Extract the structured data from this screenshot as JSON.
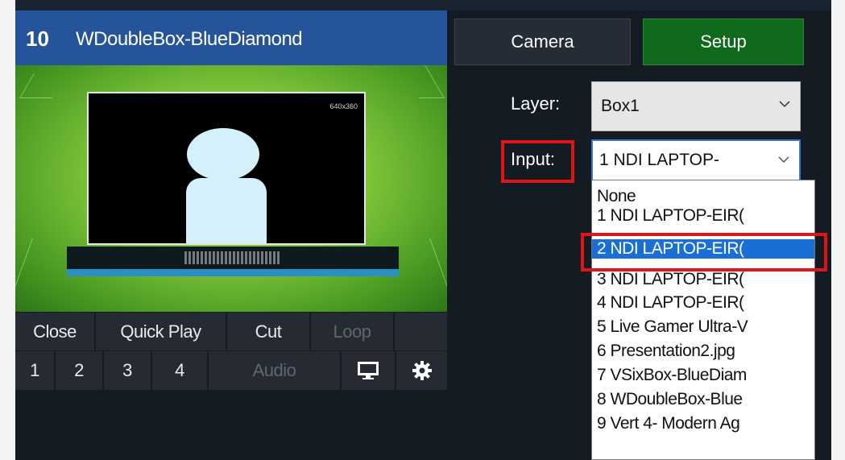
{
  "input_panel": {
    "number": "10",
    "title": "WDoubleBox-BlueDiamond",
    "resolution": "640x360",
    "controls_row1": [
      {
        "label": "Close",
        "enabled": true
      },
      {
        "label": "Quick Play",
        "enabled": true
      },
      {
        "label": "Cut",
        "enabled": true
      },
      {
        "label": "Loop",
        "enabled": false
      }
    ],
    "controls_row2": [
      {
        "label": "1"
      },
      {
        "label": "2"
      },
      {
        "label": "3"
      },
      {
        "label": "4"
      },
      {
        "label": "Audio",
        "enabled": false
      }
    ],
    "icons": [
      "monitor-icon",
      "gear-icon"
    ]
  },
  "tabs": {
    "camera": "Camera",
    "setup": "Setup",
    "setup_color": "#0f6b1b"
  },
  "layer": {
    "label": "Layer:",
    "value": "Box1"
  },
  "input": {
    "label": "Input:",
    "value": "1 NDI LAPTOP-"
  },
  "dropdown": {
    "selected_index": 2,
    "options": [
      "None",
      "1 NDI LAPTOP-EIR(",
      "2 NDI LAPTOP-EIR(",
      "3 NDI LAPTOP-EIR(",
      "4 NDI LAPTOP-EIR(",
      "5 Live Gamer Ultra-V",
      "6 Presentation2.jpg",
      "7 VSixBox-BlueDiam",
      "8 WDoubleBox-Blue",
      "9 Vert 4- Modern Ag"
    ]
  },
  "colors": {
    "header_blue": "#25549a",
    "highlight_red": "#e01616",
    "selection_blue": "#1a6fd6"
  }
}
